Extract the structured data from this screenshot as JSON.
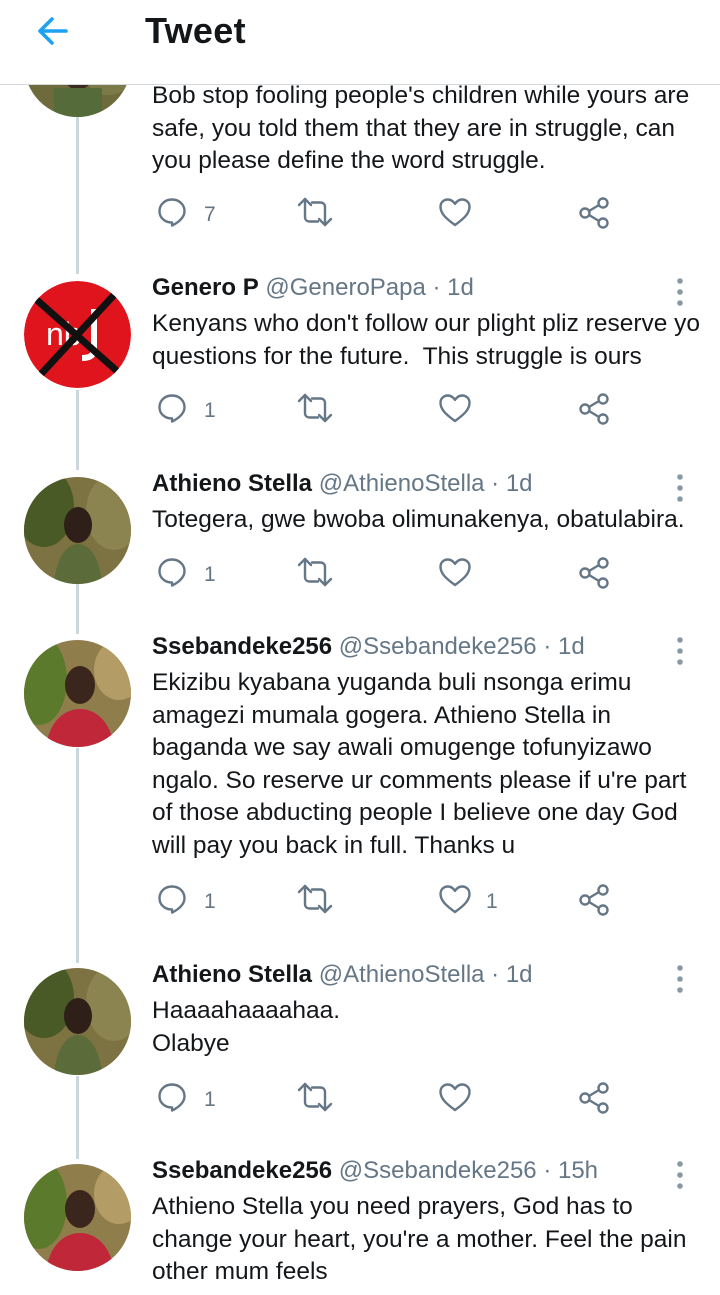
{
  "header": {
    "title": "Tweet"
  },
  "tweets": [
    {
      "text": "Bob stop fooling people's children while yours are safe, you told them that they are in struggle, can you please define the word struggle.",
      "reply_count": "7"
    },
    {
      "name": "Genero P",
      "handle": "@GeneroPapa",
      "time": "· 1d",
      "text": "Kenyans who don't follow our plight pliz reserve yo questions for the future.  This struggle is ours",
      "reply_count": "1",
      "avatar_logo": "nb"
    },
    {
      "name": "Athieno Stella",
      "handle": "@AthienoStella",
      "time": "· 1d",
      "text": "Totegera, gwe bwoba olimunakenya, obatulabira.",
      "reply_count": "1"
    },
    {
      "name": "Ssebandeke256",
      "handle": "@Ssebandeke256",
      "time": "· 1d",
      "text": "Ekizibu kyabana yuganda buli nsonga erimu amagezi mumala gogera. Athieno Stella in baganda we say awali omugenge tofunyizawo ngalo. So reserve ur comments please if u're part of those abducting people I believe one day God will pay you back in full. Thanks u",
      "reply_count": "1",
      "like_count": "1"
    },
    {
      "name": "Athieno Stella",
      "handle": "@AthienoStella",
      "time": "· 1d",
      "text": "Haaaahaaaahaa.\nOlabye",
      "reply_count": "1"
    },
    {
      "name": "Ssebandeke256",
      "handle": "@Ssebandeke256",
      "time": "· 15h",
      "text": "Athieno Stella you need prayers, God has to change your heart, you're a mother. Feel the pain other mum feels"
    }
  ],
  "colors": {
    "accent": "#1da1f2",
    "secondary_text": "#657786",
    "thread_line": "#ccd6dd",
    "avatar_red": "#e0141d"
  },
  "icons": [
    "back-arrow-icon",
    "reply-icon",
    "retweet-icon",
    "like-icon",
    "share-icon",
    "more-vertical-icon"
  ]
}
